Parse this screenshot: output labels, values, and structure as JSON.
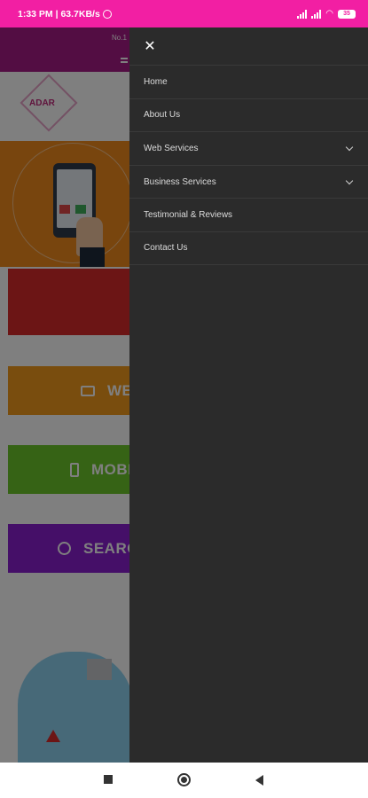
{
  "status_bar": {
    "time_speed": "1:33 PM | 63.7KB/s",
    "battery": "35"
  },
  "background_page": {
    "header_tag": "No.1",
    "logo_text": "ADAR",
    "blocks": [
      {
        "label": "WE"
      },
      {
        "label": "MOBI"
      },
      {
        "label": "SEARC"
      }
    ]
  },
  "drawer": {
    "close_symbol": "✕",
    "items": [
      {
        "label": "Home",
        "has_submenu": false
      },
      {
        "label": "About Us",
        "has_submenu": false
      },
      {
        "label": "Web Services",
        "has_submenu": true
      },
      {
        "label": "Business Services",
        "has_submenu": true
      },
      {
        "label": "Testimonial & Reviews",
        "has_submenu": false
      },
      {
        "label": "Contact Us",
        "has_submenu": false
      }
    ]
  },
  "colors": {
    "status_bar": "#f21fa3",
    "drawer_bg": "#2b2b2b",
    "header_bg": "#a61a86"
  },
  "icons": {
    "close": "close-icon",
    "expand": "chevron-down-icon",
    "recents": "recents-icon",
    "home": "home-icon",
    "back": "back-icon"
  }
}
